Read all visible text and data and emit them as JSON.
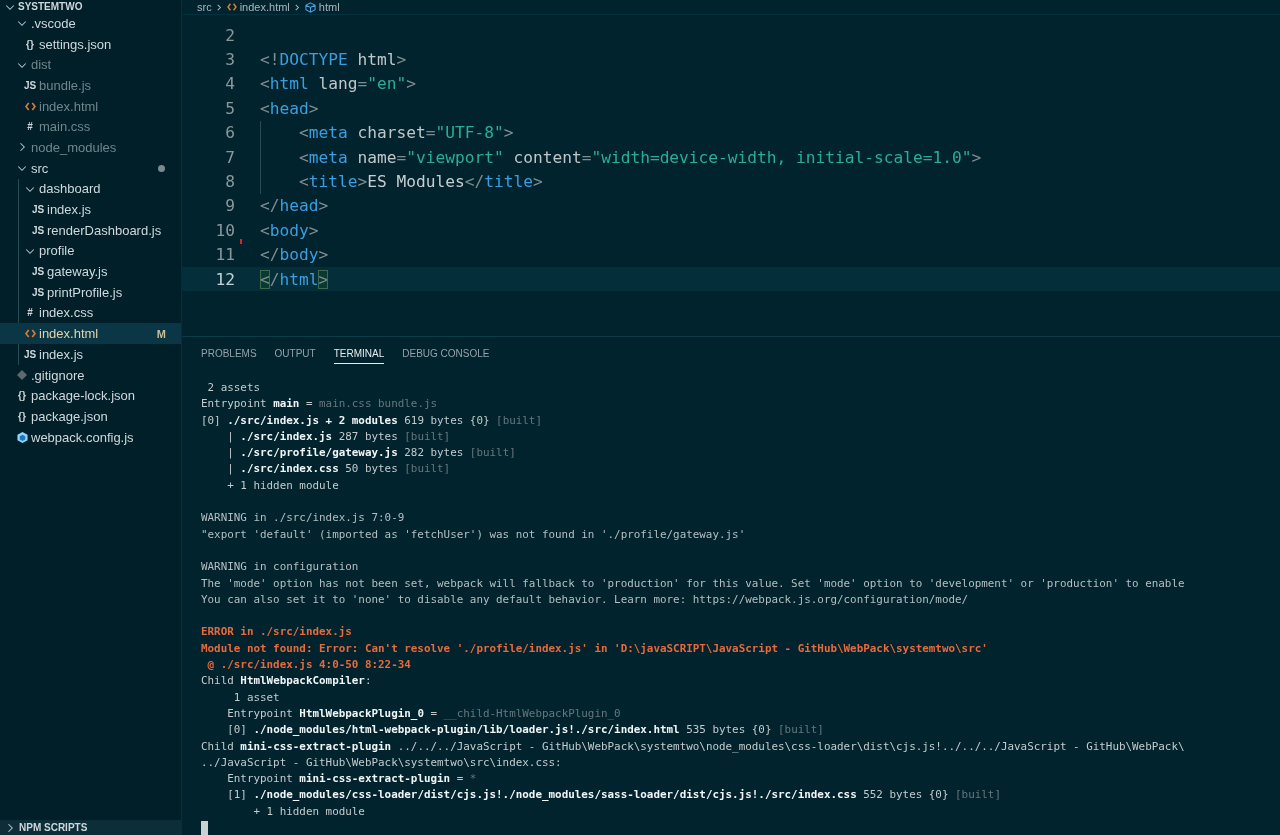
{
  "explorer": {
    "title": "SYSTEMTWO",
    "tree": [
      {
        "name": ".vscode",
        "kind": "folder",
        "expanded": true,
        "selected": false,
        "dimmed": false,
        "modified": false,
        "children": [
          {
            "name": "settings.json",
            "kind": "json",
            "icon_text": "{}",
            "selected": false,
            "dimmed": false,
            "modified": false
          }
        ]
      },
      {
        "name": "dist",
        "kind": "folder",
        "expanded": true,
        "selected": false,
        "dimmed": true,
        "modified": false,
        "children": [
          {
            "name": "bundle.js",
            "kind": "js",
            "icon_text": "JS",
            "selected": false,
            "dimmed": true,
            "modified": false
          },
          {
            "name": "index.html",
            "kind": "html",
            "selected": false,
            "dimmed": true,
            "modified": false
          },
          {
            "name": "main.css",
            "kind": "css",
            "icon_text": "#",
            "selected": false,
            "dimmed": true,
            "modified": false
          }
        ]
      },
      {
        "name": "node_modules",
        "kind": "folder",
        "expanded": false,
        "selected": false,
        "dimmed": true,
        "modified": false
      },
      {
        "name": "src",
        "kind": "folder",
        "expanded": true,
        "selected": false,
        "dimmed": false,
        "modified": true,
        "children": [
          {
            "name": "dashboard",
            "kind": "folder",
            "expanded": true,
            "selected": false,
            "dimmed": false,
            "modified": false,
            "children": [
              {
                "name": "index.js",
                "kind": "js",
                "icon_text": "JS",
                "selected": false,
                "dimmed": false,
                "modified": false
              },
              {
                "name": "renderDashboard.js",
                "kind": "js",
                "icon_text": "JS",
                "selected": false,
                "dimmed": false,
                "modified": false
              }
            ]
          },
          {
            "name": "profile",
            "kind": "folder",
            "expanded": true,
            "selected": false,
            "dimmed": false,
            "modified": false,
            "children": [
              {
                "name": "gateway.js",
                "kind": "js",
                "icon_text": "JS",
                "selected": false,
                "dimmed": false,
                "modified": false
              },
              {
                "name": "printProfile.js",
                "kind": "js",
                "icon_text": "JS",
                "selected": false,
                "dimmed": false,
                "modified": false
              }
            ]
          },
          {
            "name": "index.css",
            "kind": "css",
            "icon_text": "#",
            "selected": false,
            "dimmed": false,
            "modified": false
          },
          {
            "name": "index.html",
            "kind": "html",
            "selected": true,
            "dimmed": false,
            "modified": true,
            "badge": "M"
          },
          {
            "name": "index.js",
            "kind": "js",
            "icon_text": "JS",
            "selected": false,
            "dimmed": false,
            "modified": false
          }
        ]
      },
      {
        "name": ".gitignore",
        "kind": "git",
        "selected": false,
        "dimmed": false,
        "modified": false
      },
      {
        "name": "package-lock.json",
        "kind": "json",
        "icon_text": "{}",
        "selected": false,
        "dimmed": false,
        "modified": false
      },
      {
        "name": "package.json",
        "kind": "json",
        "icon_text": "{}",
        "selected": false,
        "dimmed": false,
        "modified": false
      },
      {
        "name": "webpack.config.js",
        "kind": "webpack",
        "selected": false,
        "dimmed": false,
        "modified": false
      }
    ]
  },
  "npm_scripts": {
    "title": "NPM SCRIPTS",
    "expanded": false
  },
  "breadcrumb": [
    {
      "label": "src",
      "kind": "folder"
    },
    {
      "label": "index.html",
      "kind": "html"
    },
    {
      "label": "html",
      "kind": "element"
    }
  ],
  "editor": {
    "lines": [
      {
        "number": "2",
        "current": false,
        "indented": false
      },
      {
        "number": "3",
        "current": false,
        "indented": false,
        "tokens": [
          {
            "t": "<!",
            "kind": "punct"
          },
          {
            "t": "DOCTYPE",
            "kind": "tag"
          },
          {
            "t": " html",
            "kind": "attr"
          },
          {
            "t": ">",
            "kind": "punct"
          }
        ]
      },
      {
        "number": "4",
        "current": false,
        "indented": false,
        "tokens": [
          {
            "t": "<",
            "kind": "punct"
          },
          {
            "t": "html",
            "kind": "tag"
          },
          {
            "t": " lang",
            "kind": "attr"
          },
          {
            "t": "=",
            "kind": "punct"
          },
          {
            "t": "\"en\"",
            "kind": "string"
          },
          {
            "t": ">",
            "kind": "punct"
          }
        ]
      },
      {
        "number": "5",
        "current": false,
        "indented": false,
        "tokens": [
          {
            "t": "<",
            "kind": "punct"
          },
          {
            "t": "head",
            "kind": "tag"
          },
          {
            "t": ">",
            "kind": "punct"
          }
        ]
      },
      {
        "number": "6",
        "current": false,
        "indented": true,
        "tokens": [
          {
            "t": "<",
            "kind": "punct"
          },
          {
            "t": "meta",
            "kind": "tag"
          },
          {
            "t": " charset",
            "kind": "attr"
          },
          {
            "t": "=",
            "kind": "punct"
          },
          {
            "t": "\"UTF-8\"",
            "kind": "string"
          },
          {
            "t": ">",
            "kind": "punct"
          }
        ]
      },
      {
        "number": "7",
        "current": false,
        "indented": true,
        "tokens": [
          {
            "t": "<",
            "kind": "punct"
          },
          {
            "t": "meta",
            "kind": "tag"
          },
          {
            "t": " name",
            "kind": "attr"
          },
          {
            "t": "=",
            "kind": "punct"
          },
          {
            "t": "\"viewport\"",
            "kind": "string"
          },
          {
            "t": " content",
            "kind": "attr"
          },
          {
            "t": "=",
            "kind": "punct"
          },
          {
            "t": "\"width=device-width, initial-scale=1.0\"",
            "kind": "string"
          },
          {
            "t": ">",
            "kind": "punct"
          }
        ]
      },
      {
        "number": "8",
        "current": false,
        "indented": true,
        "tokens": [
          {
            "t": "<",
            "kind": "punct"
          },
          {
            "t": "title",
            "kind": "tag"
          },
          {
            "t": ">",
            "kind": "punct"
          },
          {
            "t": "ES Modules",
            "kind": "text"
          },
          {
            "t": "</",
            "kind": "punct"
          },
          {
            "t": "title",
            "kind": "tag"
          },
          {
            "t": ">",
            "kind": "punct"
          }
        ]
      },
      {
        "number": "9",
        "current": false,
        "indented": false,
        "tokens": [
          {
            "t": "</",
            "kind": "punct"
          },
          {
            "t": "head",
            "kind": "tag"
          },
          {
            "t": ">",
            "kind": "punct"
          }
        ]
      },
      {
        "number": "10",
        "current": false,
        "indented": false,
        "tokens": [
          {
            "t": "<",
            "kind": "punct"
          },
          {
            "t": "body",
            "kind": "tag"
          },
          {
            "t": ">",
            "kind": "punct"
          }
        ]
      },
      {
        "number": "11",
        "current": false,
        "indented": false,
        "tokens": [
          {
            "t": "</",
            "kind": "punct"
          },
          {
            "t": "body",
            "kind": "tag"
          },
          {
            "t": ">",
            "kind": "punct"
          }
        ]
      },
      {
        "number": "12",
        "current": true,
        "indented": false,
        "tokens": [
          {
            "t": "<",
            "kind": "match"
          },
          {
            "t": "/",
            "kind": "punct"
          },
          {
            "t": "html",
            "kind": "tag"
          },
          {
            "t": ">",
            "kind": "match"
          }
        ]
      }
    ]
  },
  "panel": {
    "tabs": [
      {
        "label": "PROBLEMS",
        "selected": false
      },
      {
        "label": "OUTPUT",
        "selected": false
      },
      {
        "label": "TERMINAL",
        "selected": true
      },
      {
        "label": "DEBUG CONSOLE",
        "selected": false
      }
    ],
    "terminal": [
      {
        "kind": "text",
        "segments": [
          {
            "t": " 2 assets",
            "kind": "normal"
          }
        ]
      },
      {
        "kind": "text",
        "segments": [
          {
            "t": "Entrypoint ",
            "kind": "normal"
          },
          {
            "t": "main",
            "kind": "bold"
          },
          {
            "t": " = ",
            "kind": "normal"
          },
          {
            "t": "main.css bundle.js",
            "kind": "dim"
          }
        ]
      },
      {
        "kind": "text",
        "segments": [
          {
            "t": "[0] ",
            "kind": "normal"
          },
          {
            "t": "./src/index.js + 2 modules",
            "kind": "bold"
          },
          {
            "t": " 619 bytes {0} ",
            "kind": "normal"
          },
          {
            "t": "[built]",
            "kind": "dim"
          }
        ]
      },
      {
        "kind": "text",
        "segments": [
          {
            "t": "    | ",
            "kind": "normal"
          },
          {
            "t": "./src/index.js",
            "kind": "bold"
          },
          {
            "t": " 287 bytes ",
            "kind": "normal"
          },
          {
            "t": "[built]",
            "kind": "dim"
          }
        ]
      },
      {
        "kind": "text",
        "segments": [
          {
            "t": "    | ",
            "kind": "normal"
          },
          {
            "t": "./src/profile/gateway.js",
            "kind": "bold"
          },
          {
            "t": " 282 bytes ",
            "kind": "normal"
          },
          {
            "t": "[built]",
            "kind": "dim"
          }
        ]
      },
      {
        "kind": "text",
        "segments": [
          {
            "t": "    | ",
            "kind": "normal"
          },
          {
            "t": "./src/index.css",
            "kind": "bold"
          },
          {
            "t": " 50 bytes ",
            "kind": "normal"
          },
          {
            "t": "[built]",
            "kind": "dim"
          }
        ]
      },
      {
        "kind": "text",
        "segments": [
          {
            "t": "    + 1 hidden module",
            "kind": "normal"
          }
        ]
      },
      {
        "kind": "blank"
      },
      {
        "kind": "text",
        "segments": [
          {
            "t": "WARNING in ./src/index.js 7:0-9",
            "kind": "warn"
          }
        ]
      },
      {
        "kind": "text",
        "segments": [
          {
            "t": "\"export 'default' (imported as 'fetchUser') was not found in './profile/gateway.js'",
            "kind": "warn"
          }
        ]
      },
      {
        "kind": "blank"
      },
      {
        "kind": "text",
        "segments": [
          {
            "t": "WARNING in configuration",
            "kind": "warn"
          }
        ]
      },
      {
        "kind": "text",
        "segments": [
          {
            "t": "The 'mode' option has not been set, webpack will fallback to 'production' for this value. Set 'mode' option to 'development' or 'production' to enable",
            "kind": "warn"
          }
        ]
      },
      {
        "kind": "text",
        "segments": [
          {
            "t": "You can also set it to 'none' to disable any default behavior. Learn more: https://webpack.js.org/configuration/mode/",
            "kind": "warn"
          }
        ]
      },
      {
        "kind": "blank"
      },
      {
        "kind": "text",
        "segments": [
          {
            "t": "ERROR in ./src/index.js",
            "kind": "error"
          }
        ]
      },
      {
        "kind": "text",
        "segments": [
          {
            "t": "Module not found: Error: Can't resolve './profile/index.js' in 'D:\\javaSCRIPT\\JavaScript - GitHub\\WebPack\\systemtwo\\src'",
            "kind": "error"
          }
        ]
      },
      {
        "kind": "text",
        "segments": [
          {
            "t": " @ ./src/index.js 4:0-50 8:22-34",
            "kind": "error"
          }
        ]
      },
      {
        "kind": "text",
        "segments": [
          {
            "t": "Child ",
            "kind": "normal"
          },
          {
            "t": "HtmlWebpackCompiler",
            "kind": "bold"
          },
          {
            "t": ":",
            "kind": "normal"
          }
        ]
      },
      {
        "kind": "text",
        "segments": [
          {
            "t": "     1 asset",
            "kind": "normal"
          }
        ]
      },
      {
        "kind": "text",
        "segments": [
          {
            "t": "    Entrypoint ",
            "kind": "normal"
          },
          {
            "t": "HtmlWebpackPlugin_0",
            "kind": "bold"
          },
          {
            "t": " = ",
            "kind": "normal"
          },
          {
            "t": "__child-HtmlWebpackPlugin_0",
            "kind": "dim"
          }
        ]
      },
      {
        "kind": "text",
        "segments": [
          {
            "t": "    [0] ",
            "kind": "normal"
          },
          {
            "t": "./node_modules/html-webpack-plugin/lib/loader.js!./src/index.html",
            "kind": "bold"
          },
          {
            "t": " 535 bytes {0} ",
            "kind": "normal"
          },
          {
            "t": "[built]",
            "kind": "dim"
          }
        ]
      },
      {
        "kind": "text",
        "segments": [
          {
            "t": "Child ",
            "kind": "normal"
          },
          {
            "t": "mini-css-extract-plugin",
            "kind": "bold"
          },
          {
            "t": " ../../../JavaScript - GitHub\\WebPack\\systemtwo\\node_modules\\css-loader\\dist\\cjs.js!../../../JavaScript - GitHub\\WebPack\\",
            "kind": "normal"
          }
        ]
      },
      {
        "kind": "text",
        "segments": [
          {
            "t": "../JavaScript - GitHub\\WebPack\\systemtwo\\src\\index.css:",
            "kind": "normal"
          }
        ]
      },
      {
        "kind": "text",
        "segments": [
          {
            "t": "    Entrypoint ",
            "kind": "normal"
          },
          {
            "t": "mini-css-extract-plugin",
            "kind": "bold"
          },
          {
            "t": " = ",
            "kind": "normal"
          },
          {
            "t": "*",
            "kind": "dim"
          }
        ]
      },
      {
        "kind": "text",
        "segments": [
          {
            "t": "    [1] ",
            "kind": "normal"
          },
          {
            "t": "./node_modules/css-loader/dist/cjs.js!./node_modules/sass-loader/dist/cjs.js!./src/index.css",
            "kind": "bold"
          },
          {
            "t": " 552 bytes {0} ",
            "kind": "normal"
          },
          {
            "t": "[built]",
            "kind": "dim"
          }
        ]
      },
      {
        "kind": "text",
        "segments": [
          {
            "t": "        + 1 hidden module",
            "kind": "normal"
          }
        ]
      }
    ]
  }
}
